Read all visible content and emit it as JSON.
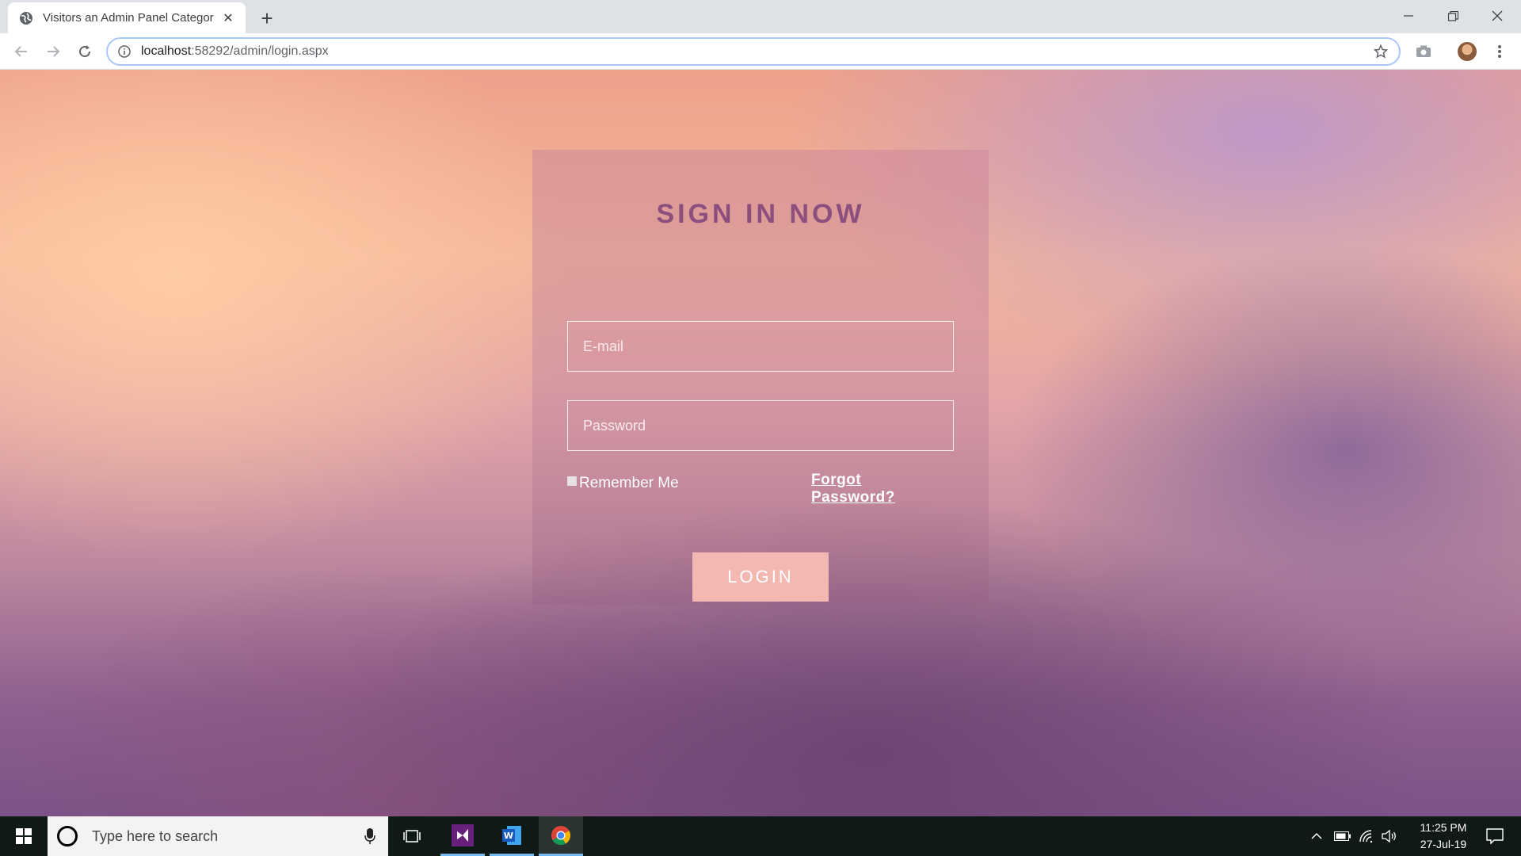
{
  "browser": {
    "tab_title": "Visitors an Admin Panel Categor",
    "url_host": "localhost",
    "url_path": ":58292/admin/login.aspx"
  },
  "login": {
    "title": "SIGN IN NOW",
    "email_placeholder": "E-mail",
    "password_placeholder": "Password",
    "remember_label": "Remember Me",
    "remember_checked": false,
    "forgot_label": "Forgot Password?",
    "button_label": "LOGIN",
    "title_color": "#8c4f7d",
    "button_color": "#f2b8b1"
  },
  "taskbar": {
    "search_placeholder": "Type here to search",
    "time": "11:25 PM",
    "date": "27-Jul-19",
    "pinned_apps": [
      "task-view",
      "visual-studio",
      "word",
      "chrome"
    ]
  }
}
